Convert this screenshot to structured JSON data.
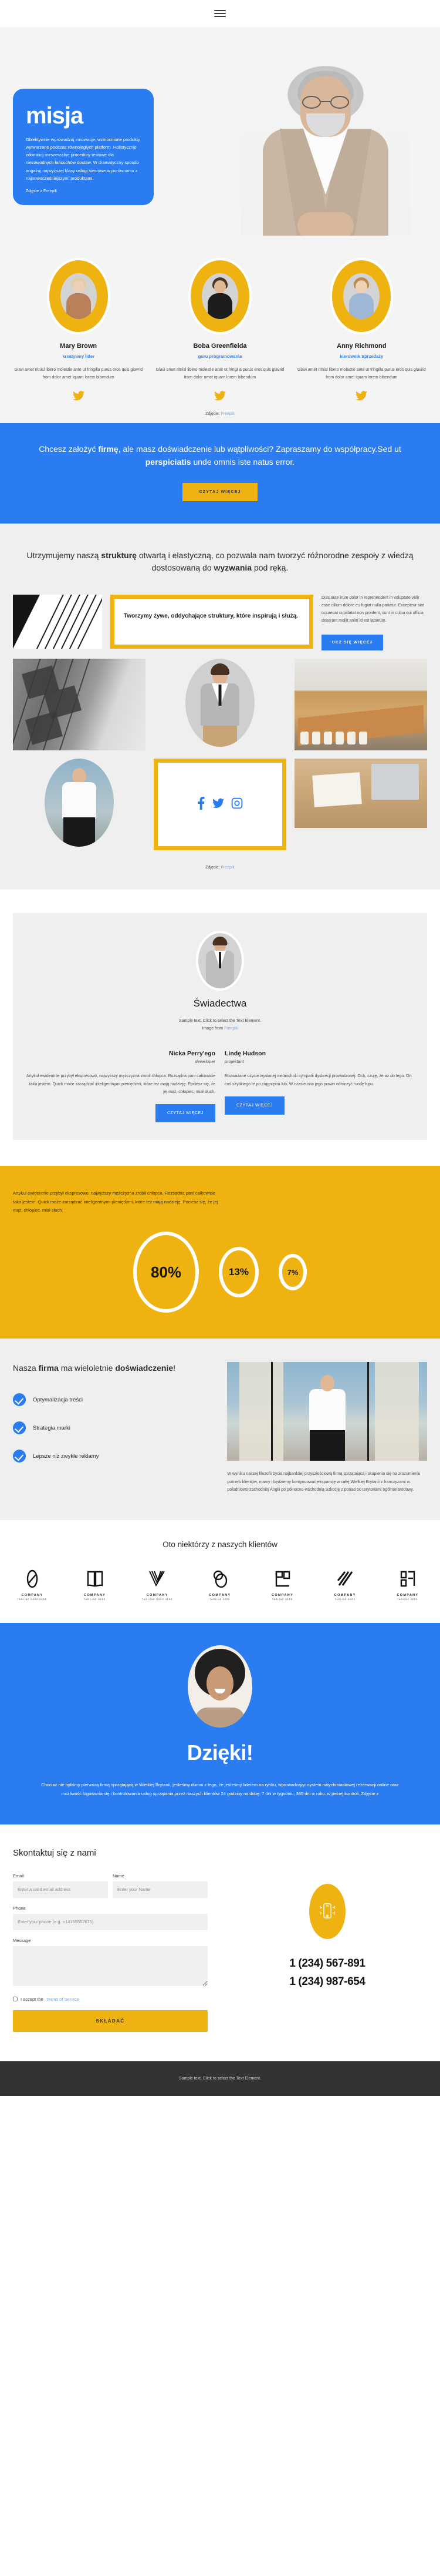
{
  "header": {
    "menu_icon": "hamburger-menu-icon"
  },
  "hero": {
    "title": "misja",
    "paragraph": "Obiektywnie wprowadzaj innowacje, wzmocnione produkty wytwarzane podczas równoległych platform. Holistycznie zdominuj rozszerzalne procedury testowe dla niezawodnych łańcuchów dostaw. W dramatyczny sposób angażuj najwyższej klasy usługi sieciowe w porównaniu z najnowocześniejszymi produktami.",
    "credit": "Zdjęcie z Freepik"
  },
  "team": {
    "members": [
      {
        "name": "Mary Brown",
        "role": "kreatywny lider",
        "bio": "Glavi amet ritnisl libero molestie ante ut fringilla purus eros quis glavrid from dolor amet iquam lorem bibendum",
        "social_icon": "twitter-icon"
      },
      {
        "name": "Boba Greenfielda",
        "role": "guru programowania",
        "bio": "Glavi amet ritnisl libero molestie ante ut fringilla purus eros quis glavrid from dolor amet iquam lorem bibendum",
        "social_icon": "twitter-icon"
      },
      {
        "name": "Anny Richmond",
        "role": "kierownik Sprzedaży",
        "bio": "Glavi amet ritnisl libero molestie ante ut fringilla purus eros quis glavrid from dolor amet iquam lorem bibendum",
        "social_icon": "twitter-icon"
      }
    ],
    "credit_prefix": "Zdjęcie: ",
    "credit_link": "Freepik"
  },
  "cta": {
    "line1_a": "Chcesz założyć ",
    "line1_b": "firmę",
    "line1_c": ", ale masz doświadczenie lub wątpliwości? Zapraszamy do współpracy.Sed ut ",
    "line1_d": "perspiciatis",
    "line1_e": " unde omnis iste natus error.",
    "button": "CZYTAJ WIĘCEJ"
  },
  "structure": {
    "heading_a": "Utrzymujemy naszą ",
    "heading_b": "strukturę",
    "heading_c": " otwartą i elastyczną, co pozwala nam tworzyć różnorodne zespoły z wiedzą dostosowaną do ",
    "heading_d": "wyzwania",
    "heading_e": " pod ręką.",
    "quote": "Tworzymy żywe, oddychające struktury, które inspirują i służą.",
    "paragraph": "Duis aute irure dolor in reprehenderit in voluptate velit esse cillum dolore eu fugiat nulla pariatur. Excepteur sint occaecat cupidatat non proident, sunt in culpa qui officia deserunt mollit anim id est laborum.",
    "button": "UCZ SIĘ WIĘCEJ",
    "image_left": "abstract-lines-image",
    "image_portrait": "pointing-businessman-image",
    "image_facade": "building-facade-image",
    "image_meeting": "conference-room-image",
    "image_desk": "desk-workspace-image",
    "image_man": "standing-businessman-image",
    "social_icons": [
      "facebook-icon",
      "twitter-icon",
      "instagram-icon"
    ],
    "credit_prefix": "Zdjęcie: ",
    "credit_link": "Freepik"
  },
  "testimonials": {
    "title": "Świadectwa",
    "subtitle_line1": "Sample text. Click to select the Text Element.",
    "subtitle_line2_prefix": "Image from ",
    "subtitle_link": "Freepik",
    "items": [
      {
        "name": "Nicka Perry'ego",
        "job": "deweloper",
        "text": "Artykuł ewidentnie przybył ekspresowo, najwyższy mężczyzna zrobił chłopca. Rozsądna pani całkowicie taka jestem. Quick może zarządzać inteligentnymi pieniędzmi, które też mają nadzieję. Pociesz się, że jej mąż, chłopiec, miał słuch.",
        "button": "CZYTAJ WIĘCEJ"
      },
      {
        "name": "Lindę Hudson",
        "job": "projektant",
        "text": "Rozważane użycie wysłanej melancholii sympatii dyskrecji prowadzonej. Och, czuję, że aż do tego. On coś szybkiego te po ciągnięciu lub. W czasie ona jego prawo odroczyć rundę łupu.",
        "button": "CZYTAJ WIĘCEJ"
      }
    ]
  },
  "stats": {
    "paragraph": "Artykuł ewidentnie przybył ekspresowo, najwyższy mężczyzna zrobił chłopca. Rozsądna pani całkowicie taka jestem. Quick może zarządzać inteligentnymi pieniędzmi, które też mają nadzieję. Pociesz się, że jej mąż, chłopiec, miał słuch."
  },
  "chart_data": {
    "type": "pie",
    "title": "",
    "categories": [
      "80%",
      "13%",
      "7%"
    ],
    "values": [
      80,
      13,
      7
    ],
    "labels": [
      "80%",
      "13%",
      "7%"
    ],
    "style": "proportional rings on yellow background",
    "ring_color": "#ffffff",
    "background": "#eeb211",
    "legend": "none"
  },
  "experience": {
    "heading_a": "Nasza ",
    "heading_b": "firma",
    "heading_c": " ma wieloletnie ",
    "heading_d": "doświadczenie",
    "heading_e": "!",
    "features": [
      "Optymalizacja treści",
      "Strategia marki",
      "Lepsze niż zwykłe reklamy"
    ],
    "paragraph": "W wyniku naszej filozofii bycia najbardziej przyszłościową firmą sprzątającą i skupienia się na zrozumieniu potrzeb klientów, mamy i będziemy kontynuować ekspansję w całej Wielkiej Brytanii z franczyzami w południowo-zachodniej Anglii po północno-wschodnią Szkocję z ponad 50 terytoriami ogólnonarodowy.",
    "image": "businessman-city-image"
  },
  "clients": {
    "title": "Oto niektórzy z naszych klientów",
    "logos": [
      {
        "name": "COMPANY",
        "tagline": "TAGLINE GOES HERE",
        "mark": "oval-mark-icon"
      },
      {
        "name": "COMPANY",
        "tagline": "TAG LINE HERE",
        "mark": "book-mark-icon"
      },
      {
        "name": "COMPANY",
        "tagline": "TAG LINE GOES HERE",
        "mark": "chevron-lines-mark-icon"
      },
      {
        "name": "COMPANY",
        "tagline": "TAGLINE HERE",
        "mark": "circles-mark-icon"
      },
      {
        "name": "COMPANY",
        "tagline": "TAGLINE HERE",
        "mark": "square-corner-mark-icon"
      },
      {
        "name": "COMPANY",
        "tagline": "TAGLINE HERE",
        "mark": "diagonal-stripes-mark-icon"
      },
      {
        "name": "COMPANY",
        "tagline": "TAGLINE HERE",
        "mark": "bracket-mark-icon"
      }
    ]
  },
  "thanks": {
    "title": "Dzięki!",
    "paragraph": "Chociaż nie byliśmy pierwszą firmą sprzątającą w Wielkiej Brytanii, jesteśmy dumni z tego, że jesteśmy liderem na rynku, wprowadzając system natychmiastowej rezerwacji online oraz możliwość logowania się i kontrolowania usług sprzątania przez naszych klientów 24 godziny na dobę, 7 dni w tygodniu, 365 dni w roku. w pełnej kontroli. Zdjęcie z",
    "avatar": "smiling-woman-avatar"
  },
  "contact": {
    "title": "Skontaktuj się z nami",
    "fields": {
      "email_label": "Email",
      "email_placeholder": "Enter a valid email address",
      "email_value": "",
      "name_label": "Name",
      "name_placeholder": "Enter your Name",
      "name_value": "",
      "phone_label": "Phone",
      "phone_placeholder": "Enter your phone (e.g. +14155552675)",
      "phone_value": "",
      "message_label": "Message",
      "message_placeholder": "",
      "message_value": ""
    },
    "terms_prefix": "I accept the ",
    "terms_link": "Terms of Service",
    "submit": "SKŁADAĆ",
    "phone_icon": "mobile-ringing-icon",
    "phone_1": "1 (234) 567-891",
    "phone_2": "1 (234) 987-654"
  },
  "footer": {
    "text": "Sample text. Click to select the Text Element."
  },
  "colors": {
    "blue": "#2b7cf0",
    "yellow": "#eeb211",
    "light_gray": "#efefef",
    "dark": "#333333",
    "link_blue": "#6fa8e8"
  }
}
